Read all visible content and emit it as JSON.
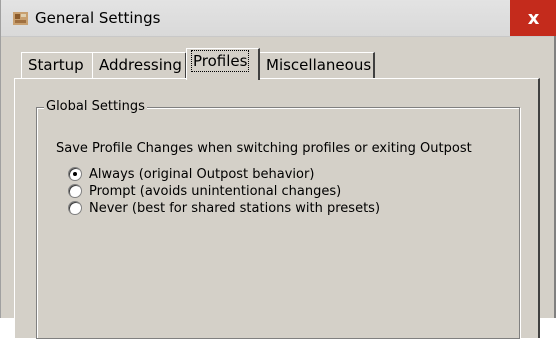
{
  "window": {
    "title": "General Settings",
    "close_label": "x"
  },
  "tabs": [
    {
      "label": "Startup",
      "active": false
    },
    {
      "label": "Addressing",
      "active": false
    },
    {
      "label": "Profiles",
      "active": true
    },
    {
      "label": "Miscellaneous",
      "active": false
    }
  ],
  "group": {
    "title": "Global Settings",
    "question": "Save Profile Changes when switching profiles or exiting Outpost",
    "options": [
      {
        "label": "Always (original Outpost behavior)",
        "checked": true
      },
      {
        "label": "Prompt (avoids unintentional changes)",
        "checked": false
      },
      {
        "label": "Never (best for shared stations with presets)",
        "checked": false
      }
    ]
  }
}
